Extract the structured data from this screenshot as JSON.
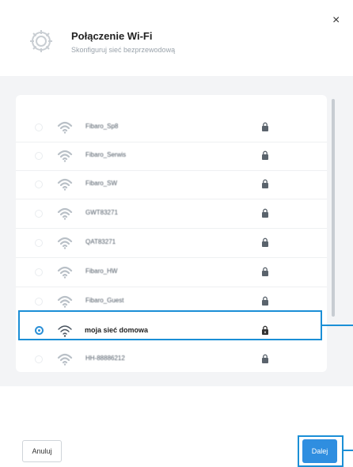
{
  "dialog": {
    "title": "Połączenie Wi-Fi",
    "subtitle": "Skonfiguruj sieć bezprzewodową",
    "close_label": "×"
  },
  "networks": [
    {
      "ssid": "Fibaro_Sp8",
      "selected": false,
      "locked": true
    },
    {
      "ssid": "Fibaro_Serwis",
      "selected": false,
      "locked": true
    },
    {
      "ssid": "Fibaro_SW",
      "selected": false,
      "locked": true
    },
    {
      "ssid": "GWT83271",
      "selected": false,
      "locked": true
    },
    {
      "ssid": "QAT83271",
      "selected": false,
      "locked": true
    },
    {
      "ssid": "Fibaro_HW",
      "selected": false,
      "locked": true
    },
    {
      "ssid": "Fibaro_Guest",
      "selected": false,
      "locked": true
    },
    {
      "ssid": "moja sieć domowa",
      "selected": true,
      "locked": true
    },
    {
      "ssid": "HH-88886212",
      "selected": false,
      "locked": true
    }
  ],
  "footer": {
    "cancel_label": "Anuluj",
    "next_label": "Dalej"
  },
  "colors": {
    "accent": "#2f8ee0",
    "highlight": "#1b8fd6"
  },
  "icons": {
    "header": "gear-icon",
    "wifi": "wifi-icon",
    "lock": "lock-icon"
  }
}
